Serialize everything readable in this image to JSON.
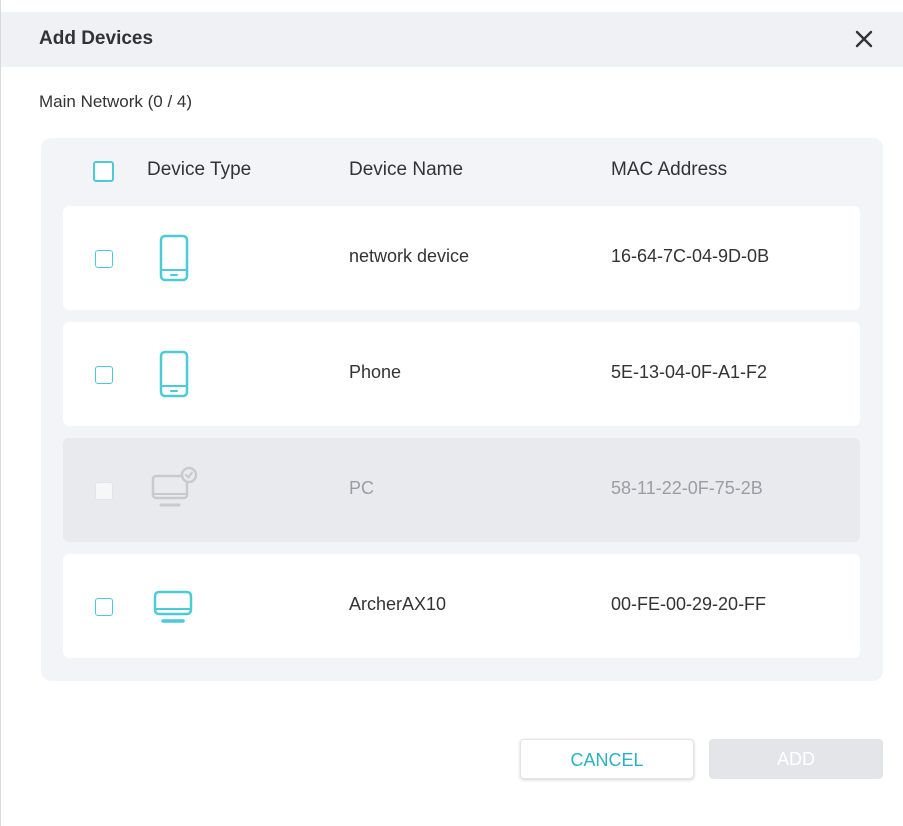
{
  "dialog": {
    "title": "Add Devices",
    "close_icon": "close-icon",
    "network_label": "Main Network (0 / 4)"
  },
  "table": {
    "columns": [
      "Device Type",
      "Device Name",
      "MAC Address"
    ],
    "rows": [
      {
        "icon": "phone-icon",
        "name": "network device",
        "mac": "16-64-7C-04-9D-0B",
        "disabled": false,
        "checked": false
      },
      {
        "icon": "phone-icon",
        "name": "Phone",
        "mac": "5E-13-04-0F-A1-F2",
        "disabled": false,
        "checked": false
      },
      {
        "icon": "pc-icon",
        "name": "PC",
        "mac": "58-11-22-0F-75-2B",
        "disabled": true,
        "checked": false
      },
      {
        "icon": "router-icon",
        "name": "ArcherAX10",
        "mac": "00-FE-00-29-20-FF",
        "disabled": false,
        "checked": false
      }
    ]
  },
  "footer": {
    "cancel_label": "CANCEL",
    "add_label": "ADD"
  },
  "colors": {
    "accent": "#4acbd6",
    "header_bg": "#eff1f5",
    "panel_bg": "#f2f4f8",
    "disabled_row": "#e8eaee",
    "disabled_button": "#e3e5e9"
  }
}
